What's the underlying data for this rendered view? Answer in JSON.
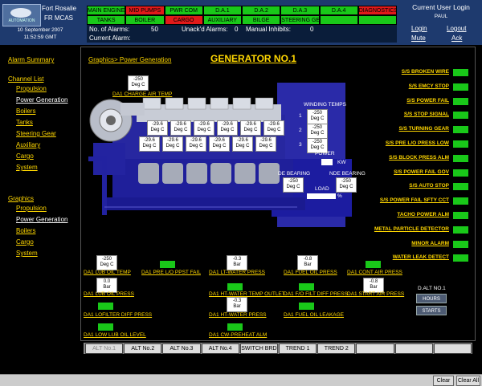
{
  "header": {
    "logo_text": "AUTOMATION",
    "vessel": "Fort Rosalie",
    "system": "FR MCAS",
    "date": "10 September 2007",
    "time": "11:52:59  GMT",
    "status_row1": [
      {
        "label": "MAIN ENGINE",
        "color": "green"
      },
      {
        "label": "MID PUMPS",
        "color": "red"
      },
      {
        "label": "PWR COM",
        "color": "green"
      },
      {
        "label": "D.A.1",
        "color": "green"
      },
      {
        "label": "D.A.2",
        "color": "green"
      },
      {
        "label": "D.A.3",
        "color": "green"
      },
      {
        "label": "D.A.4",
        "color": "green"
      },
      {
        "label": "DIAGNOSTICS",
        "color": "red"
      }
    ],
    "status_row2": [
      {
        "label": "TANKS",
        "color": "green"
      },
      {
        "label": "BOILER",
        "color": "green"
      },
      {
        "label": "CARGO",
        "color": "red"
      },
      {
        "label": "AUXILIARY",
        "color": "green"
      },
      {
        "label": "BILGE",
        "color": "green"
      },
      {
        "label": "STEERING GEAR",
        "color": "green"
      }
    ],
    "alarm_count_label": "No. of Alarms:",
    "alarm_count": "50",
    "unack_label": "Unack'd Alarms:",
    "unack_count": "0",
    "inhibit_label": "Manual Inhibits:",
    "inhibit_count": "0",
    "current_alarm_label": "Current Alarm:"
  },
  "user": {
    "title": "Current User Login",
    "name": "PAUL",
    "login": "Login",
    "logout": "Logout",
    "mute": "Mute",
    "ack": "Ack"
  },
  "nav": {
    "alarm_summary": "Alarm Summary",
    "channel_list": "Channel List",
    "channel_items": [
      "Propulsion",
      "Power Generation",
      "Boilers",
      "Tanks",
      "Steering Gear",
      "Auxiliary",
      "Cargo",
      "System"
    ],
    "graphics": "Graphics",
    "graphics_items": [
      "Propulsion",
      "Power Generation",
      "Boilers",
      "Cargo",
      "System"
    ]
  },
  "page": {
    "breadcrumb": "Graphics> Power Generation",
    "title": "GENERATOR NO.1"
  },
  "engine_sensors": {
    "charge_air": {
      "value": "-250",
      "unit": "Deg C",
      "label": "DA1 CHARGE AIR TEMP"
    },
    "top_row": [
      "-29.6",
      "-29.6",
      "-29.6",
      "-29.6",
      "-29.6",
      "-29.6"
    ],
    "bottom_row": [
      "-29.6",
      "-29.6",
      "-29.6",
      "-29.6",
      "-29.6",
      "-29.6"
    ],
    "unit": "Deg C"
  },
  "generator": {
    "winding_title": "WINDING TEMPS",
    "windings": [
      {
        "idx": "1",
        "value": "-250",
        "unit": "Deg C"
      },
      {
        "idx": "2",
        "value": "-250",
        "unit": "Deg C"
      },
      {
        "idx": "3",
        "value": "-250",
        "unit": "Deg C"
      }
    ],
    "power_label": "POWER",
    "power_unit": "KW",
    "de_bearing": {
      "label": "DE BEARING",
      "value": "-250",
      "unit": "Deg C"
    },
    "nde_bearing": {
      "label": "NDE BEARING",
      "value": "-250",
      "unit": "Deg C"
    },
    "load_label": "LOAD",
    "load_unit": "%"
  },
  "alarms_right": [
    "S/S BROKEN WIRE",
    "S/S EMCY STOP",
    "S/S POWER FAIL",
    "S/S STOP SIGNAL",
    "S/S TURNING GEAR",
    "S/S PRE L/O PRESS LOW",
    "S/S BLOCK PRESS ALM",
    "S/S POWER FAIL GOV",
    "S/S AUTO STOP",
    "S/S POWER FAIL SFTY CCT",
    "TACHO POWER ALM",
    "METAL PARTICLE DETECTOR",
    "MINOR ALARM",
    "WATER LEAK DETECT"
  ],
  "bottom_sensors": {
    "lub_oil_temp": {
      "value": "-250",
      "unit": "Deg C",
      "label": "DA1 LUB OIL TEMP"
    },
    "pre_lo_pmp": {
      "label": "DA1 PRE L/O PPST FAIL"
    },
    "lt_water": {
      "value": "-0.3",
      "unit": "Bar",
      "label": "DA1 LT-WATER PRESS"
    },
    "fuel_oil": {
      "value": "-0.8",
      "unit": "Bar",
      "label": "DA1 FUEL OIL PRESS"
    },
    "cont_air": {
      "label": "DA1 CONT AIR PRESS"
    },
    "lub_oil_press": {
      "value": "0.0",
      "unit": "Bar",
      "label": "DA1 LUB OIL PRESS"
    },
    "ht_water_temp": {
      "label": "DA1 HT-WATER TEMP OUTLET"
    },
    "fo_filt": {
      "label": "DA1 F/O FILT DIFF PRESS"
    },
    "start_air": {
      "value": "-0.8",
      "unit": "Bar",
      "label": "DA1 START AIR PRESS"
    },
    "lo_filter": {
      "label": "DA1 LOFILTER DIFF PRESS"
    },
    "ht_water_press": {
      "value": "-0.3",
      "unit": "Bar",
      "label": "DA1 HT-WATER PRESS"
    },
    "fuel_leak": {
      "label": "DA1 FUEL OIL LEAKAGE"
    },
    "low_lub": {
      "label": "DA1 LOW LUB OIL LEVEL"
    },
    "cw_preheat": {
      "label": "DA1 CW-PREHEAT ALM"
    }
  },
  "side_panel": {
    "title": "D.ALT NO.1",
    "hours": "HOURS",
    "starts": "STARTS"
  },
  "tabs": [
    "ALT No.1",
    "ALT No.2",
    "ALT No.3",
    "ALT No.4",
    "SWITCH BRD",
    "TREND 1",
    "TREND 2",
    "",
    "",
    ""
  ],
  "footer": {
    "clear": "Clear",
    "clear_all": "Clear All"
  }
}
